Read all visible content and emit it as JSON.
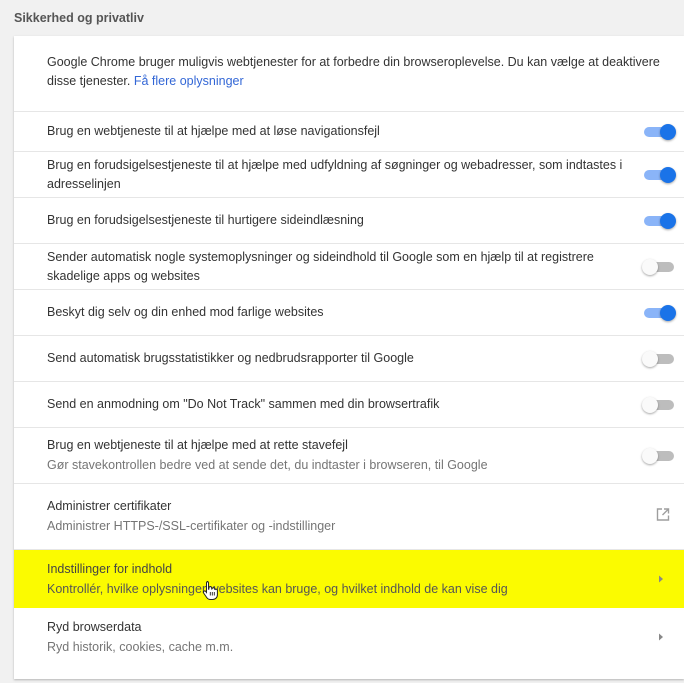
{
  "section": {
    "title": "Sikkerhed og privatliv"
  },
  "intro": {
    "text": "Google Chrome bruger muligvis webtjenester for at forbedre din browseroplevelse. Du kan vælge at deaktivere disse tjenester. ",
    "link": "Få flere oplysninger"
  },
  "rows": [
    {
      "primary": "Brug en webtjeneste til at hjælpe med at løse navigationsfejl",
      "toggle": "on"
    },
    {
      "primary": "Brug en forudsigelsestjeneste til at hjælpe med udfyldning af søgninger og webadresser, som indtastes i adresselinjen",
      "toggle": "on"
    },
    {
      "primary": "Brug en forudsigelsestjeneste til hurtigere sideindlæsning",
      "toggle": "on"
    },
    {
      "primary": "Sender automatisk nogle systemoplysninger og sideindhold til Google som en hjælp til at registrere skadelige apps og websites",
      "toggle": "off"
    },
    {
      "primary": "Beskyt dig selv og din enhed mod farlige websites",
      "toggle": "on"
    },
    {
      "primary": "Send automatisk brugsstatistikker og nedbrudsrapporter til Google",
      "toggle": "off"
    },
    {
      "primary": "Send en anmodning om \"Do Not Track\" sammen med din browsertrafik",
      "toggle": "off"
    },
    {
      "primary": "Brug en webtjeneste til at hjælpe med at rette stavefejl",
      "secondary": "Gør stavekontrollen bedre ved at sende det, du indtaster i browseren, til Google",
      "toggle": "off"
    }
  ],
  "certificates": {
    "primary": "Administrer certifikater",
    "secondary": "Administrer HTTPS-/SSL-certifikater og -indstillinger",
    "icon": "external-link-icon"
  },
  "content_settings": {
    "primary": "Indstillinger for indhold",
    "secondary": "Kontrollér, hvilke oplysninger websites kan bruge, og hvilket indhold de kan vise dig",
    "icon": "arrow-right-icon",
    "highlight_color": "#fbfb00"
  },
  "clear_data": {
    "primary": "Ryd browserdata",
    "secondary": "Ryd historik, cookies, cache m.m.",
    "icon": "arrow-right-icon"
  },
  "colors": {
    "toggle_on_knob": "#1a73e8",
    "toggle_on_track": "#8ab4f8",
    "toggle_off_track": "#bdbdbd",
    "link": "#3367d6"
  }
}
